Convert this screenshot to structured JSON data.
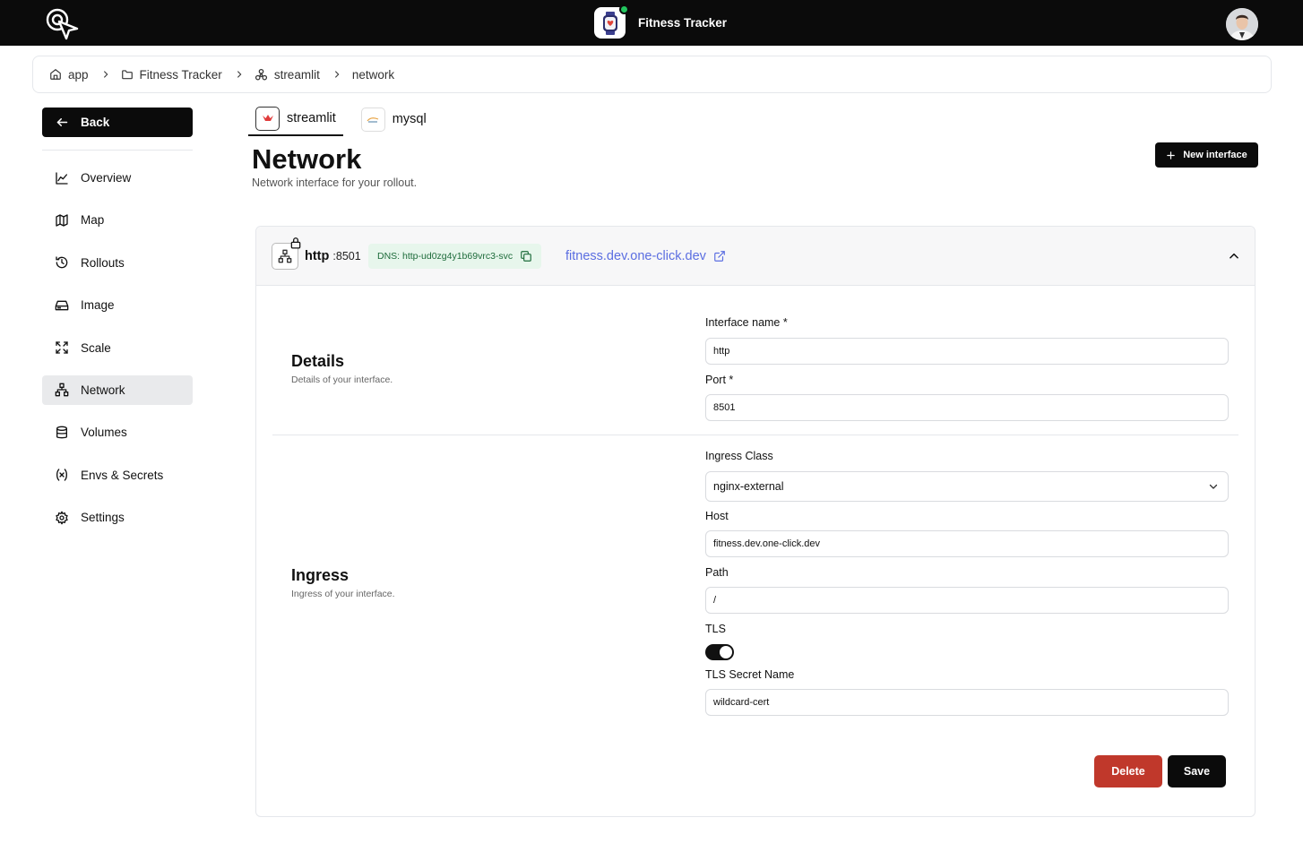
{
  "app": {
    "title": "Fitness Tracker",
    "status_color": "#22c55e"
  },
  "breadcrumb": {
    "items": [
      {
        "label": "app",
        "icon": "home-icon"
      },
      {
        "label": "Fitness Tracker",
        "icon": "folder-icon"
      },
      {
        "label": "streamlit",
        "icon": "cluster-icon"
      },
      {
        "label": "network",
        "icon": ""
      }
    ]
  },
  "sidebar": {
    "back_label": "Back",
    "items": [
      {
        "label": "Overview",
        "icon": "chart-line-icon",
        "active": false
      },
      {
        "label": "Map",
        "icon": "map-icon",
        "active": false
      },
      {
        "label": "Rollouts",
        "icon": "history-icon",
        "active": false
      },
      {
        "label": "Image",
        "icon": "hard-drive-icon",
        "active": false
      },
      {
        "label": "Scale",
        "icon": "expand-icon",
        "active": false
      },
      {
        "label": "Network",
        "icon": "network-icon",
        "active": true
      },
      {
        "label": "Volumes",
        "icon": "database-icon",
        "active": false
      },
      {
        "label": "Envs & Secrets",
        "icon": "variable-icon",
        "active": false
      },
      {
        "label": "Settings",
        "icon": "gear-icon",
        "active": false
      }
    ]
  },
  "tabs": [
    {
      "label": "streamlit",
      "active": true
    },
    {
      "label": "mysql",
      "active": false
    }
  ],
  "page": {
    "title": "Network",
    "subtitle": "Network interface for your rollout.",
    "new_button": "New interface"
  },
  "interface": {
    "name": "http",
    "port": ":8501",
    "dns": "DNS: http-ud0zg4y1b69vrc3-svc",
    "url": "fitness.dev.one-click.dev"
  },
  "details": {
    "title": "Details",
    "subtitle": "Details of your interface.",
    "name_label": "Interface name *",
    "name_value": "http",
    "port_label": "Port *",
    "port_value": "8501"
  },
  "ingress": {
    "title": "Ingress",
    "subtitle": "Ingress of your interface.",
    "class_label": "Ingress Class",
    "class_value": "nginx-external",
    "host_label": "Host",
    "host_value": "fitness.dev.one-click.dev",
    "path_label": "Path",
    "path_value": "/",
    "tls_label": "TLS",
    "tls_enabled": true,
    "tls_secret_label": "TLS Secret Name",
    "tls_secret_value": "wildcard-cert"
  },
  "actions": {
    "delete": "Delete",
    "save": "Save",
    "delete_color": "#c0382b"
  }
}
